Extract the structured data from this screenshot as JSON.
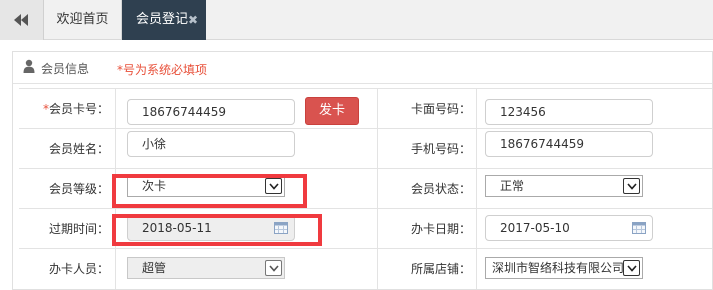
{
  "tabs": {
    "home": "欢迎首页",
    "active": "会员登记",
    "close": "✖"
  },
  "panel": {
    "title": "会员信息",
    "note": "*号为系统必填项"
  },
  "form": {
    "card_no": {
      "required_mark": "*",
      "label": "会员卡号：",
      "value": "18676744459"
    },
    "issue_button": "发卡",
    "face_no": {
      "label": "卡面号码：",
      "value": "123456"
    },
    "name": {
      "label": "会员姓名：",
      "value": "小徐"
    },
    "phone": {
      "label": "手机号码：",
      "value": "18676744459"
    },
    "level": {
      "label": "会员等级：",
      "value": "次卡"
    },
    "status": {
      "label": "会员状态：",
      "value": "正常"
    },
    "expire": {
      "label": "过期时间：",
      "value": "2018-05-11"
    },
    "issue_date": {
      "label": "办卡日期：",
      "value": "2017-05-10"
    },
    "operator": {
      "label": "办卡人员：",
      "value": "超管"
    },
    "store": {
      "label": "所属店铺：",
      "value": "深圳市智络科技有限公司"
    }
  },
  "colors": {
    "tab_active_bg": "#2f4050",
    "issue_button_bg": "#d9534f",
    "highlight": "#f03a3f",
    "note": "#e8503a"
  }
}
